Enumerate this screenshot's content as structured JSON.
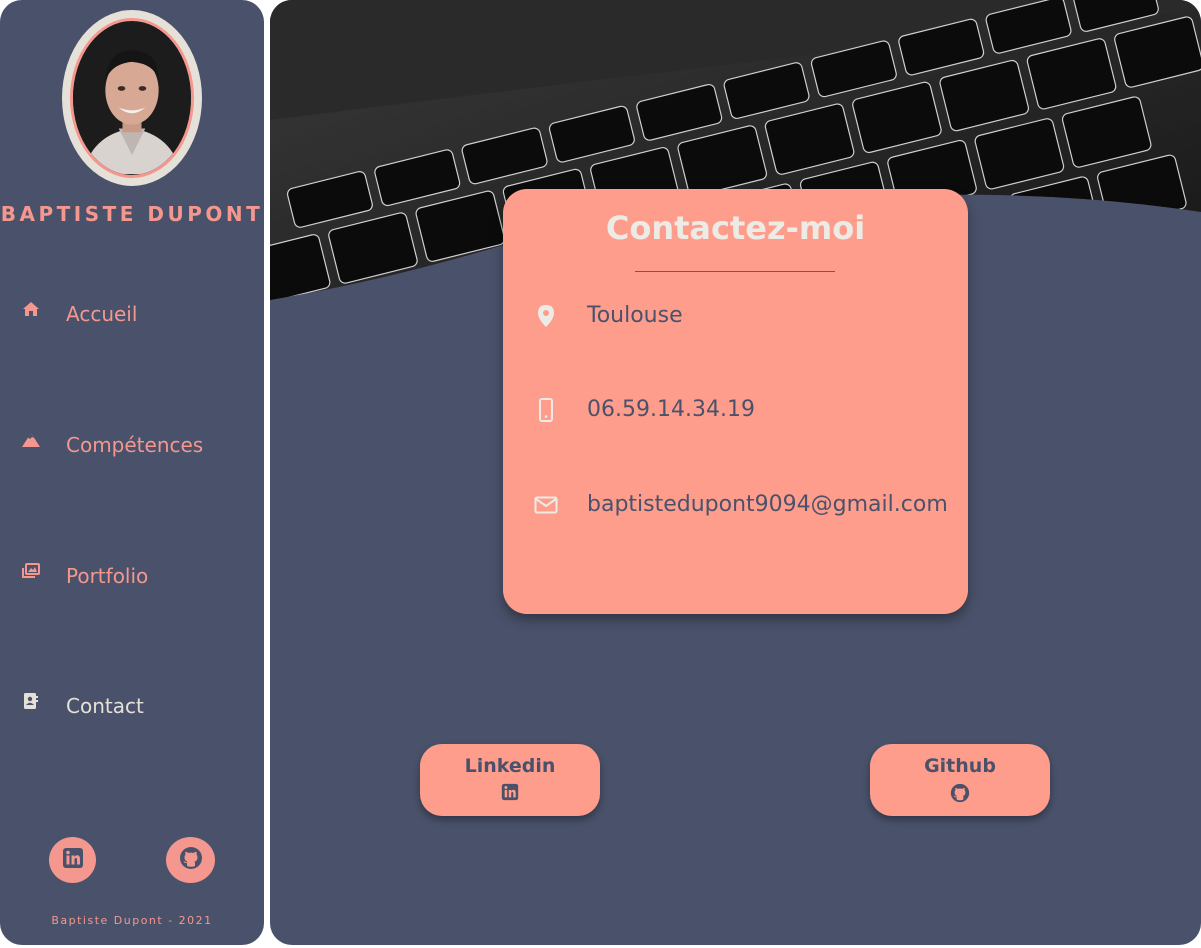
{
  "profile": {
    "name": "BAPTISTE DUPONT",
    "avatar_icon": "profile-photo"
  },
  "nav": {
    "items": [
      {
        "label": "Accueil",
        "icon": "home-icon"
      },
      {
        "label": "Compétences",
        "icon": "mountain-icon"
      },
      {
        "label": "Portfolio",
        "icon": "images-icon"
      },
      {
        "label": "Contact",
        "icon": "address-book-icon",
        "active": true
      }
    ]
  },
  "social": {
    "linkedin_icon": "linkedin-icon",
    "github_icon": "github-icon"
  },
  "footer": {
    "text": "Baptiste Dupont - 2021"
  },
  "contact": {
    "title": "Contactez-moi",
    "location": "Toulouse",
    "phone": "06.59.14.34.19",
    "email": "baptistedupont9094@gmail.com"
  },
  "buttons": {
    "linkedin_label": "Linkedin",
    "github_label": "Github"
  },
  "colors": {
    "background": "#4a526b",
    "accent": "#f4978e",
    "card": "#ff9d8c",
    "light": "#e6e1d8"
  }
}
